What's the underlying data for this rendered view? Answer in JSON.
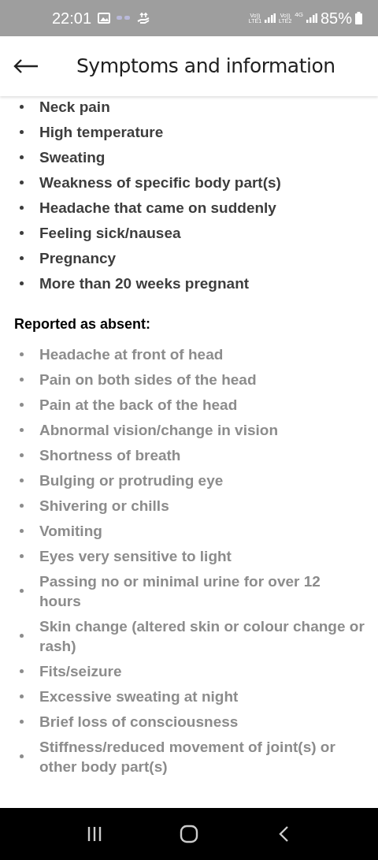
{
  "status_bar": {
    "time": "22:01",
    "sim1": {
      "volte": "Vo))",
      "network": "LTE1"
    },
    "sim2": {
      "volte": "Vo))",
      "network": "LTE2",
      "data": "4G"
    },
    "battery": "85%"
  },
  "header": {
    "title": "Symptoms and information"
  },
  "present": [
    "Neck pain",
    "High temperature",
    "Sweating",
    "Weakness of specific body part(s)",
    "Headache that came on suddenly",
    "Feeling sick/nausea",
    "Pregnancy",
    "More than 20 weeks pregnant"
  ],
  "absent": {
    "heading": "Reported as absent:",
    "items": [
      "Headache at front of head",
      "Pain on both sides of the head",
      "Pain at the back of the head",
      "Abnormal vision/change in vision",
      "Shortness of breath",
      "Bulging or protruding eye",
      "Shivering or chills",
      "Vomiting",
      "Eyes very sensitive to light",
      "Passing no or minimal urine for over 12 hours",
      "Skin change (altered skin or colour change or rash)",
      "Fits/seizure",
      "Excessive sweating at night",
      "Brief loss of consciousness",
      "Stiffness/reduced movement of joint(s) or other body part(s)"
    ]
  }
}
